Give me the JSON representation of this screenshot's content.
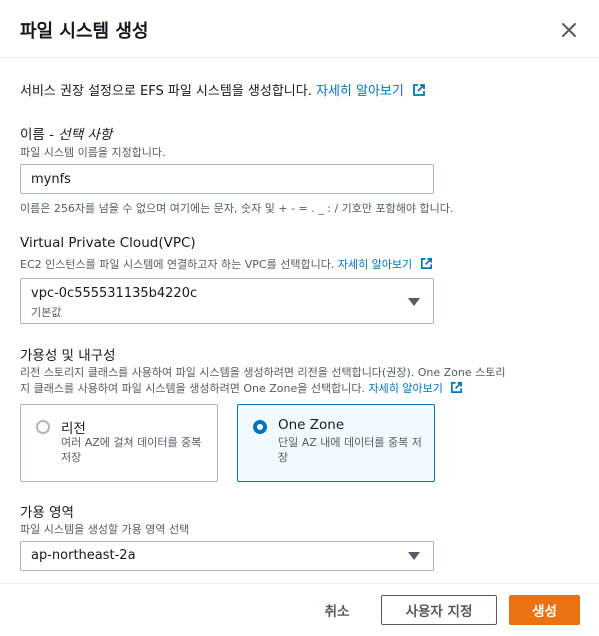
{
  "dialog": {
    "title": "파일 시스템 생성",
    "intro_text": "서비스 권장 설정으로 EFS 파일 시스템을 생성합니다.",
    "intro_link": "자세히 알아보기"
  },
  "name_field": {
    "label": "이름 - ",
    "label_optional": "선택 사항",
    "description": "파일 시스템 이름을 지정합니다.",
    "value": "mynfs",
    "constraint": "이름은 256자를 넘을 수 없으며 여기에는 문자, 숫자 및 + - = . _ : / 기호만 포함해야 합니다."
  },
  "vpc_field": {
    "label": "Virtual Private Cloud(VPC)",
    "description": "EC2 인스턴스를 파일 시스템에 연결하고자 하는 VPC를 선택합니다.",
    "link": "자세히 알아보기",
    "selected_value": "vpc-0c555531135b4220c",
    "selected_sub": "기본값"
  },
  "availability": {
    "label": "가용성 및 내구성",
    "description_line1": "리전 스토리지 클래스를 사용하여 파일 시스템을 생성하려면 리전을 선택합니다(권장). One Zone 스토리",
    "description_line2": "지 클래스를 사용하여 파일 시스템을 생성하려면 One Zone을 선택합니다.",
    "link": "자세히 알아보기",
    "options": [
      {
        "label": "리전",
        "description": "여러 AZ에 걸쳐 데이터를 중복 저장",
        "selected": false
      },
      {
        "label": "One Zone",
        "description": "단일 AZ 내에 데이터를 중복 저장",
        "selected": true
      }
    ]
  },
  "az_field": {
    "label": "가용 영역",
    "description": "파일 시스템을 생성할 가용 영역 선택",
    "selected_value": "ap-northeast-2a"
  },
  "footer": {
    "cancel_label": "취소",
    "customize_label": "사용자 지정",
    "create_label": "생성"
  },
  "colors": {
    "link": "#0073bb",
    "primary": "#ec7211",
    "selected_tile_bg": "#f1faff"
  }
}
